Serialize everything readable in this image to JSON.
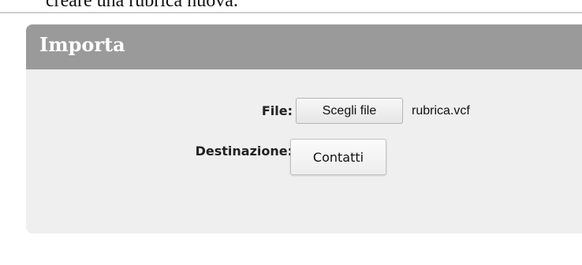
{
  "intro_text": "creare una rubrica nuova.",
  "panel": {
    "title": "Importa",
    "file_label": "File:",
    "choose_file_button": "Scegli file",
    "selected_file": "rubrica.vcf",
    "destination_label": "Destinazione:",
    "destination_value": "Contatti"
  }
}
